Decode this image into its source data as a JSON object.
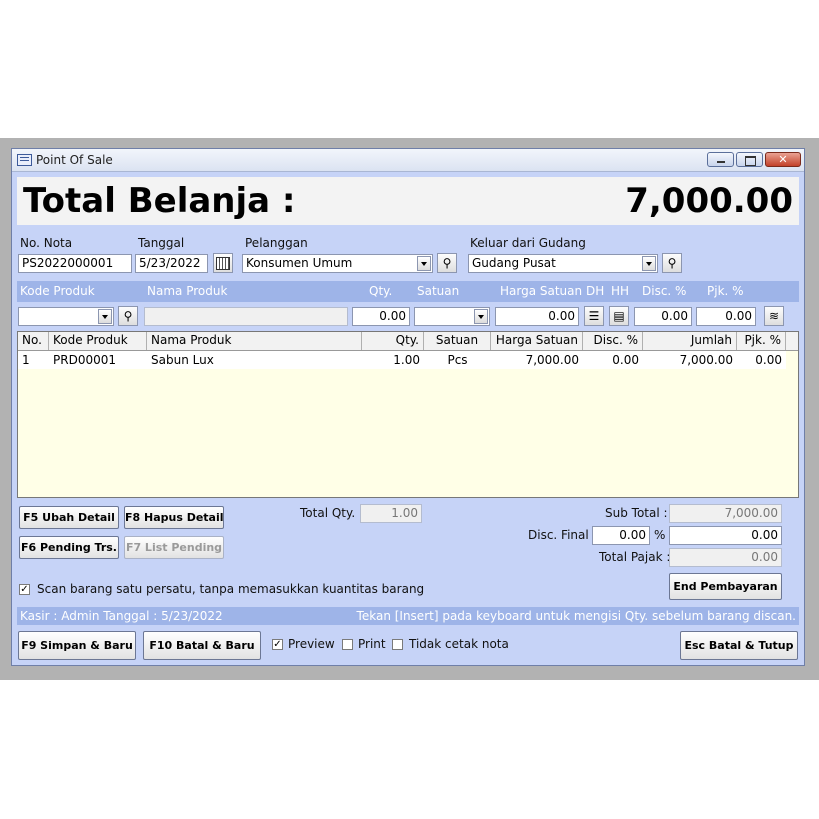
{
  "window": {
    "title": "Point Of Sale"
  },
  "total": {
    "label": "Total Belanja :",
    "value": "7,000.00"
  },
  "form": {
    "no_nota_label": "No. Nota",
    "no_nota_value": "PS2022000001",
    "tanggal_label": "Tanggal",
    "tanggal_value": "5/23/2022",
    "pelanggan_label": "Pelanggan",
    "pelanggan_value": "Konsumen Umum",
    "gudang_label": "Keluar dari Gudang",
    "gudang_value": "Gudang Pusat"
  },
  "entry_header": {
    "kode": "Kode Produk",
    "nama": "Nama Produk",
    "qty": "Qty.",
    "satuan": "Satuan",
    "harga": "Harga Satuan",
    "dh": "DH",
    "hh": "HH",
    "disc": "Disc. %",
    "pjk": "Pjk. %"
  },
  "entry_row": {
    "qty": "0.00",
    "harga": "0.00",
    "disc": "0.00",
    "pjk": "0.00"
  },
  "grid": {
    "columns": [
      "No.",
      "Kode Produk",
      "Nama Produk",
      "Qty.",
      "Satuan",
      "Harga Satuan",
      "Disc. %",
      "Jumlah",
      "Pjk. %"
    ],
    "rows": [
      {
        "no": "1",
        "kode": "PRD00001",
        "nama": "Sabun Lux",
        "qty": "1.00",
        "satuan": "Pcs",
        "harga": "7,000.00",
        "disc": "0.00",
        "jumlah": "7,000.00",
        "pjk": "0.00"
      }
    ]
  },
  "buttons": {
    "ubah": "F5 Ubah Detail",
    "hapus": "F8 Hapus Detail",
    "pending": "F6 Pending Trs.",
    "list": "F7 List Pending",
    "end": "End Pembayaran",
    "simpan": "F9 Simpan & Baru",
    "batal": "F10 Batal & Baru",
    "tutup": "Esc Batal & Tutup"
  },
  "summary": {
    "total_qty_label": "Total Qty.",
    "total_qty_value": "1.00",
    "sub_total_label": "Sub Total :",
    "sub_total_value": "7,000.00",
    "disc_final_label": "Disc. Final :",
    "disc_final_pct": "0.00",
    "pct_sign": "%",
    "disc_final_value": "0.00",
    "pajak_label": "Total Pajak :",
    "pajak_value": "0.00"
  },
  "scan": {
    "label": "Scan barang satu persatu, tanpa memasukkan kuantitas barang",
    "checked": true
  },
  "status": {
    "left": "Kasir : Admin Tanggal : 5/23/2022",
    "right": "Tekan [Insert] pada keyboard untuk mengisi Qty. sebelum barang discan."
  },
  "options": {
    "preview": "Preview",
    "print": "Print",
    "tidak_cetak": "Tidak cetak nota",
    "preview_checked": true,
    "print_checked": false,
    "tidak_cetak_checked": false
  }
}
